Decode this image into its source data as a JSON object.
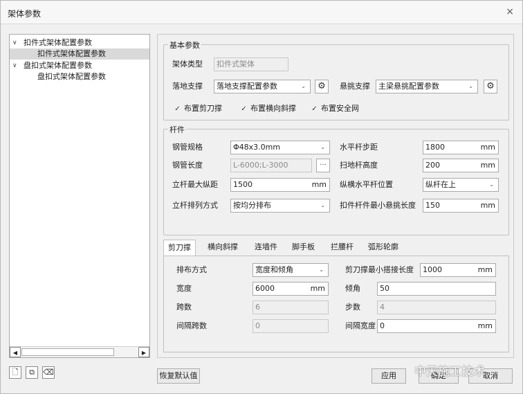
{
  "window": {
    "title": "架体参数",
    "close_glyph": "×"
  },
  "tree": {
    "nodes": [
      {
        "label": "扣件式架体配置参数",
        "chevron": "∨"
      },
      {
        "label": "扣件式架体配置参数"
      },
      {
        "label": "盘扣式架体配置参数",
        "chevron": "∨"
      },
      {
        "label": "盘扣式架体配置参数"
      }
    ],
    "scroll_left": "◀",
    "scroll_right": "▶"
  },
  "bottom_icons": [
    {
      "icon": "new-document-icon",
      "glyph": "🗋"
    },
    {
      "icon": "copy-document-icon",
      "glyph": "⧉"
    },
    {
      "icon": "eraser-icon",
      "glyph": "⌫"
    }
  ],
  "basic": {
    "legend": "基本参数",
    "frame_type_label": "架体类型",
    "frame_type_value": "扣件式架体",
    "ground_support_label": "落地支撑",
    "ground_support_value": "落地支撑配置参数",
    "cantilever_label": "悬挑支撑",
    "cantilever_value": "主梁悬挑配置参数",
    "checks": [
      {
        "label": "布置剪刀撑",
        "checked": true
      },
      {
        "label": "布置横向斜撑",
        "checked": true
      },
      {
        "label": "布置安全网",
        "checked": true
      }
    ],
    "check_glyph": "✓",
    "dropdown_glyph": "⌄",
    "gear_glyph": "⚙"
  },
  "rods": {
    "legend": "杆件",
    "steel_spec_label": "钢管规格",
    "steel_spec_value": "Φ48x3.0mm",
    "steel_length_label": "钢管长度",
    "steel_length_value": "L-6000;L-3000",
    "ellipsis": "···",
    "max_long_spacing_label": "立杆最大纵距",
    "max_long_spacing_value": "1500",
    "arrangement_label": "立杆排列方式",
    "arrangement_value": "按均分排布",
    "horizontal_step_label": "水平杆步距",
    "horizontal_step_value": "1800",
    "sweep_height_label": "扫地杆高度",
    "sweep_height_value": "200",
    "cross_pos_label": "纵横水平杆位置",
    "cross_pos_value": "纵杆在上",
    "min_overhang_label": "扣件杆件最小悬挑长度",
    "min_overhang_value": "150",
    "unit": "mm"
  },
  "tabs": [
    "剪刀撑",
    "横向斜撑",
    "连墙件",
    "脚手板",
    "拦腰杆",
    "弧形轮廓"
  ],
  "scissor": {
    "layout_label": "排布方式",
    "layout_value": "宽度和倾角",
    "min_lap_label": "剪刀撑最小搭接长度",
    "min_lap_value": "1000",
    "width_label": "宽度",
    "width_value": "6000",
    "angle_label": "倾角",
    "angle_value": "50",
    "spans_label": "跨数",
    "spans_value": "6",
    "steps_label": "步数",
    "steps_value": "4",
    "gap_spans_label": "间隔跨数",
    "gap_spans_value": "0",
    "gap_width_label": "间隔宽度",
    "gap_width_value": "0",
    "unit": "mm"
  },
  "footer": {
    "restore_default": "恢复默认值",
    "apply": "应用",
    "ok": "确定",
    "cancel": "取消"
  },
  "watermark": "中天施工技术"
}
